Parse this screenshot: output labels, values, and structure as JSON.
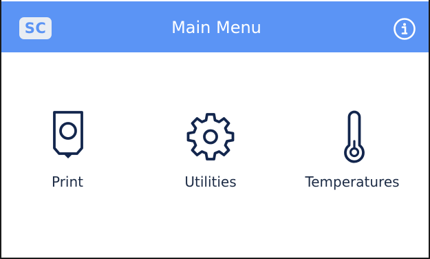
{
  "header": {
    "logo_text": "SC",
    "title": "Main Menu",
    "info_icon": "info-circle-icon"
  },
  "menu": {
    "items": [
      {
        "label": "Print",
        "icon": "print-icon"
      },
      {
        "label": "Utilities",
        "icon": "gear-icon"
      },
      {
        "label": "Temperatures",
        "icon": "thermometer-icon"
      }
    ]
  },
  "colors": {
    "header_background": "#5b94f5",
    "icon_stroke": "#13264d",
    "label_text": "#1c2b45",
    "background": "#ffffff"
  }
}
